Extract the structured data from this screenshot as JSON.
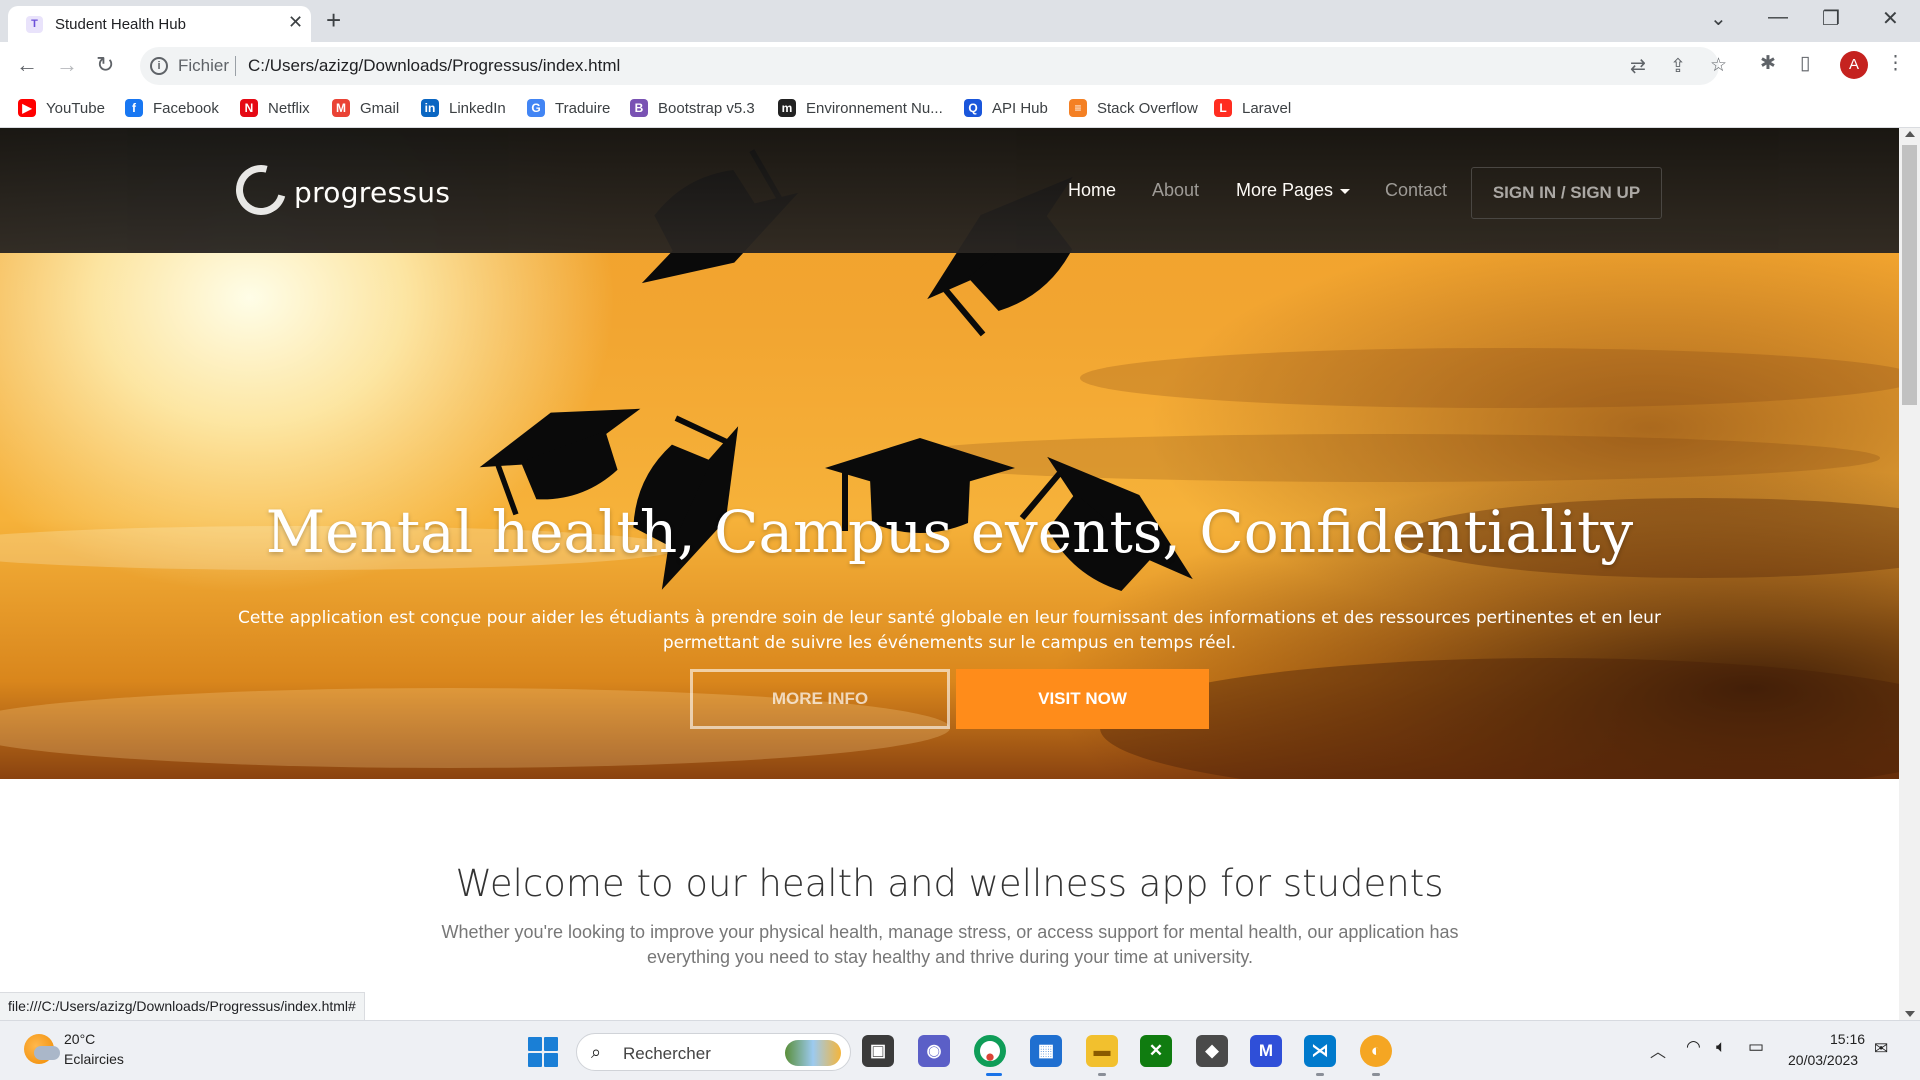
{
  "browser": {
    "tab_title": "Student Health Hub",
    "tab_favicon_letter": "T",
    "scheme_label": "Fichier",
    "url": "C:/Users/azizg/Downloads/Progressus/index.html",
    "profile_initial": "A",
    "status_url": "file:///C:/Users/azizg/Downloads/Progressus/index.html#"
  },
  "bookmarks": [
    {
      "label": "YouTube",
      "icon": "youtube-icon",
      "color": "#ff0000",
      "glyph": "▶"
    },
    {
      "label": "Facebook",
      "icon": "facebook-icon",
      "color": "#1877f2",
      "glyph": "f"
    },
    {
      "label": "Netflix",
      "icon": "netflix-icon",
      "color": "#e50914",
      "glyph": "N"
    },
    {
      "label": "Gmail",
      "icon": "gmail-icon",
      "color": "#ea4335",
      "glyph": "M"
    },
    {
      "label": "LinkedIn",
      "icon": "linkedin-icon",
      "color": "#0a66c2",
      "glyph": "in"
    },
    {
      "label": "Traduire",
      "icon": "translate-icon",
      "color": "#4285f4",
      "glyph": "G"
    },
    {
      "label": "Bootstrap v5.3",
      "icon": "bootstrap-icon",
      "color": "#7952b3",
      "glyph": "B"
    },
    {
      "label": "Environnement Nu...",
      "icon": "environnement-icon",
      "color": "#222222",
      "glyph": "m"
    },
    {
      "label": "API Hub",
      "icon": "api-hub-icon",
      "color": "#1a56db",
      "glyph": "Q"
    },
    {
      "label": "Stack Overflow",
      "icon": "stackoverflow-icon",
      "color": "#f48024",
      "glyph": "≡"
    },
    {
      "label": "Laravel",
      "icon": "laravel-icon",
      "color": "#ff2d20",
      "glyph": "L"
    }
  ],
  "site": {
    "logo": "progressus",
    "nav": {
      "home": "Home",
      "about": "About",
      "more_pages": "More Pages",
      "contact": "Contact",
      "signin": "SIGN IN / SIGN UP"
    },
    "hero": {
      "title": "Mental health, Campus events, Confidentiality",
      "text": "Cette application est conçue pour aider les étudiants à prendre soin de leur santé globale en leur fournissant des informations et des ressources pertinentes et en leur permettant de suivre les événements sur le campus en temps réel.",
      "btn_more": "MORE INFO",
      "btn_visit": "VISIT NOW"
    },
    "welcome": {
      "title": "Welcome to our health and wellness app for students",
      "text": "Whether you're looking to improve your physical health, manage stress, or access support for mental health, our application has everything you need to stay healthy and thrive during your time at university."
    }
  },
  "taskbar": {
    "weather_temp": "20°C",
    "weather_desc": "Eclaircies",
    "search_placeholder": "Rechercher",
    "time": "15:16",
    "date": "20/03/2023"
  },
  "colors": {
    "accent_orange": "#ff8c1a",
    "navbar": "#1a1a1a"
  }
}
